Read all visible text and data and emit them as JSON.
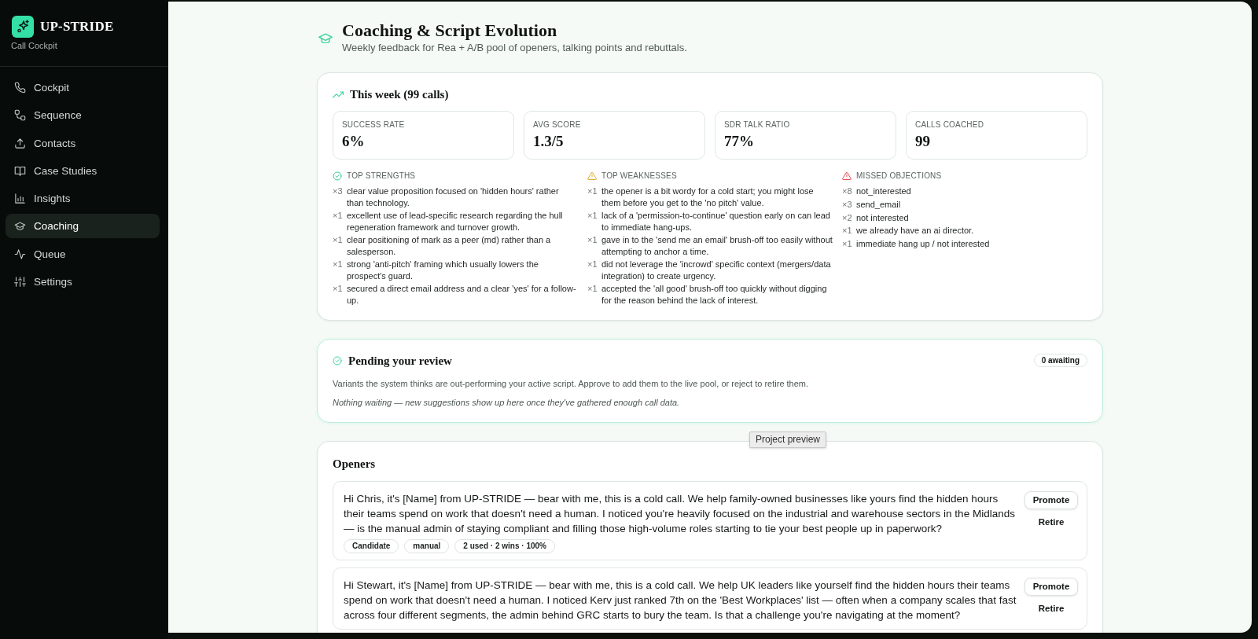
{
  "sidebar": {
    "brand": "UP-STRIDE",
    "subtitle": "Call Cockpit",
    "items": [
      {
        "label": "Cockpit",
        "selected": false
      },
      {
        "label": "Sequence",
        "selected": false
      },
      {
        "label": "Contacts",
        "selected": false
      },
      {
        "label": "Case Studies",
        "selected": false
      },
      {
        "label": "Insights",
        "selected": false
      },
      {
        "label": "Coaching",
        "selected": true
      },
      {
        "label": "Queue",
        "selected": false
      },
      {
        "label": "Settings",
        "selected": false
      }
    ]
  },
  "header": {
    "title": "Coaching & Script Evolution",
    "subtitle": "Weekly feedback for Rea + A/B pool of openers, talking points and rebuttals."
  },
  "summary": {
    "title": "This week (99 calls)",
    "stats": [
      {
        "label": "SUCCESS RATE",
        "value": "6%"
      },
      {
        "label": "AVG SCORE",
        "value": "1.3/5"
      },
      {
        "label": "SDR TALK RATIO",
        "value": "77%"
      },
      {
        "label": "CALLS COACHED",
        "value": "99"
      }
    ],
    "lists": [
      {
        "kind": "strengths",
        "title": "TOP STRENGTHS",
        "items": [
          {
            "count": "×3",
            "text": "clear value proposition focused on 'hidden hours' rather than technology."
          },
          {
            "count": "×1",
            "text": "excellent use of lead-specific research regarding the hull regeneration framework and turnover growth."
          },
          {
            "count": "×1",
            "text": "clear positioning of mark as a peer (md) rather than a salesperson."
          },
          {
            "count": "×1",
            "text": "strong 'anti-pitch' framing which usually lowers the prospect's guard."
          },
          {
            "count": "×1",
            "text": "secured a direct email address and a clear 'yes' for a follow-up."
          }
        ]
      },
      {
        "kind": "weaknesses",
        "title": "TOP WEAKNESSES",
        "items": [
          {
            "count": "×1",
            "text": "the opener is a bit wordy for a cold start; you might lose them before you get to the 'no pitch' value."
          },
          {
            "count": "×1",
            "text": "lack of a 'permission-to-continue' question early on can lead to immediate hang-ups."
          },
          {
            "count": "×1",
            "text": "gave in to the 'send me an email' brush-off too easily without attempting to anchor a time."
          },
          {
            "count": "×1",
            "text": "did not leverage the 'incrowd' specific context (mergers/data integration) to create urgency."
          },
          {
            "count": "×1",
            "text": "accepted the 'all good' brush-off too quickly without digging for the reason behind the lack of interest."
          }
        ]
      },
      {
        "kind": "objections",
        "title": "MISSED OBJECTIONS",
        "items": [
          {
            "count": "×8",
            "text": "not_interested"
          },
          {
            "count": "×3",
            "text": "send_email"
          },
          {
            "count": "×2",
            "text": "not interested"
          },
          {
            "count": "×1",
            "text": "we already have an ai director."
          },
          {
            "count": "×1",
            "text": "immediate hang up / not interested"
          }
        ]
      }
    ]
  },
  "review": {
    "title": "Pending your review",
    "badge": "0 awaiting",
    "description": "Variants the system thinks are out-performing your active script. Approve to add them to the live pool, or reject to retire them.",
    "empty_note": "Nothing waiting — new suggestions show up here once they've gathered enough call data."
  },
  "tooltip": {
    "text": "Project preview"
  },
  "openers": {
    "title": "Openers",
    "items": [
      {
        "text": "Hi Chris, it's [Name] from UP-STRIDE — bear with me, this is a cold call. We help family-owned businesses like yours find the hidden hours their teams spend on work that doesn't need a human. I noticed you're heavily focused on the industrial and warehouse sectors in the Midlands — is the manual admin of staying compliant and filling those high-volume roles starting to tie your best people up in paperwork?",
        "tags": [
          "Candidate",
          "manual",
          "2 used · 2 wins · 100%"
        ],
        "actions": [
          {
            "label": "Promote",
            "kind": "primary"
          },
          {
            "label": "Retire",
            "kind": "plain"
          }
        ]
      },
      {
        "text": "Hi Stewart, it's [Name] from UP-STRIDE — bear with me, this is a cold call. We help UK leaders like yourself find the hidden hours their teams spend on work that doesn't need a human. I noticed Kerv just ranked 7th on the 'Best Workplaces' list — often when a company scales that fast across four different segments, the admin behind GRC starts to bury the team. Is that a challenge you're navigating at the moment?",
        "actions": [
          {
            "label": "Promote",
            "kind": "primary"
          },
          {
            "label": "Retire",
            "kind": "plain"
          }
        ]
      }
    ]
  }
}
